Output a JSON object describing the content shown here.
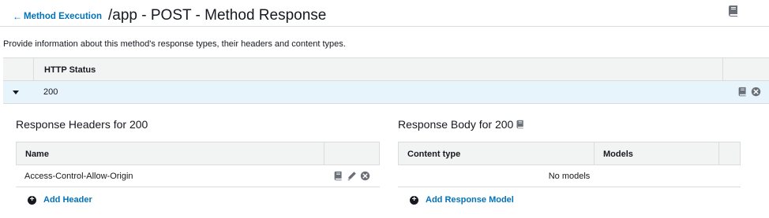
{
  "header": {
    "back_link_label": "Method Execution",
    "back_arrow": "🡐",
    "title": "/app - POST - Method Response",
    "docs_icon": "book-icon"
  },
  "description": "Provide information about this method's response types, their headers and content types.",
  "status_table": {
    "column_header": "HTTP Status",
    "rows": [
      {
        "status": "200",
        "expanded": true
      }
    ]
  },
  "response_headers": {
    "title": "Response Headers for 200",
    "columns": [
      "Name",
      ""
    ],
    "rows": [
      {
        "name": "Access-Control-Allow-Origin",
        "icons": [
          "book-icon",
          "pencil-icon",
          "remove-icon"
        ]
      }
    ],
    "add_label": "Add Header"
  },
  "response_body": {
    "title": "Response Body for 200",
    "columns": [
      "Content type",
      "Models",
      ""
    ],
    "empty_text": "No models",
    "add_label": "Add Response Model"
  },
  "colors": {
    "link": "#0073bb",
    "row_highlight": "#e8f4fc",
    "table_header_bg": "#f2f3f3",
    "border": "#dcdcdc",
    "icon_gray": "#6b7078"
  }
}
